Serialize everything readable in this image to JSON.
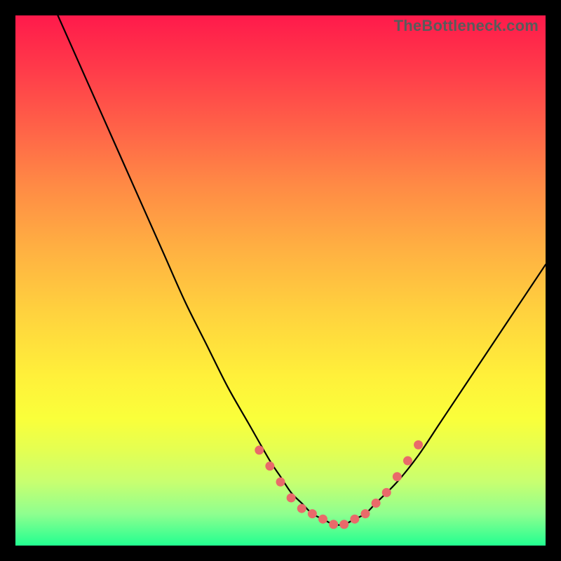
{
  "watermark": "TheBottleneck.com",
  "colors": {
    "background": "#000000",
    "curve": "#000000",
    "dots": "#e96a6a",
    "gradient_top": "#ff1a4b",
    "gradient_bottom": "#22ff90"
  },
  "chart_data": {
    "type": "line",
    "title": "",
    "xlabel": "",
    "ylabel": "",
    "xlim": [
      0,
      100
    ],
    "ylim": [
      0,
      100
    ],
    "grid": false,
    "legend": false,
    "series": [
      {
        "name": "curve",
        "x": [
          8,
          12,
          16,
          20,
          24,
          28,
          32,
          36,
          40,
          44,
          48,
          50,
          52,
          54,
          56,
          58,
          60,
          62,
          64,
          66,
          68,
          72,
          76,
          80,
          84,
          88,
          92,
          96,
          100
        ],
        "y": [
          100,
          91,
          82,
          73,
          64,
          55,
          46,
          38,
          30,
          23,
          16,
          13,
          10,
          8,
          6,
          5,
          4,
          4,
          5,
          6,
          8,
          12,
          17,
          23,
          29,
          35,
          41,
          47,
          53
        ]
      }
    ],
    "markers": {
      "name": "highlighted-points",
      "x": [
        46,
        48,
        50,
        52,
        54,
        56,
        58,
        60,
        62,
        64,
        66,
        68,
        70,
        72,
        74,
        76
      ],
      "y": [
        18,
        15,
        12,
        9,
        7,
        6,
        5,
        4,
        4,
        5,
        6,
        8,
        10,
        13,
        16,
        19
      ]
    }
  }
}
